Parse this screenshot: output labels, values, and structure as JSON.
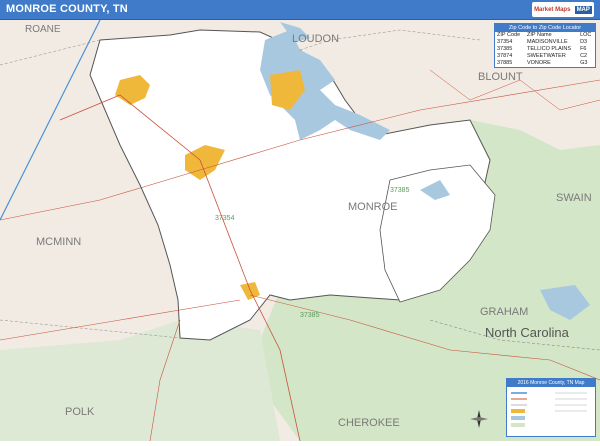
{
  "header": {
    "title": "MONROE COUNTY, TN",
    "logo_text": "Market Maps",
    "logo_badge": "MAP"
  },
  "map": {
    "colors": {
      "county_fill": "#ffffff",
      "surrounding": "#f2ebe4",
      "forest": "#d3e6c8",
      "water": "#a8c8e0",
      "urban": "#f0b83a",
      "road": "#c8523b",
      "border": "#555555",
      "highway": "#4a90d9"
    },
    "region_labels": {
      "roane": "ROANE",
      "loudon": "LOUDON",
      "blount": "BLOUNT",
      "mcminn": "MCMINN",
      "monroe": "MONROE",
      "swain": "SWAIN",
      "graham": "GRAHAM",
      "north_carolina": "North Carolina",
      "polk": "POLK",
      "cherokee": "CHEROKEE"
    },
    "zip_labels": {
      "z37354": "37354",
      "z37385": "37385",
      "z37385b": "37385"
    }
  },
  "zip_locator": {
    "title": "Zip Code to Zip Code Locator",
    "columns": [
      "ZIP Code",
      "ZIP Name",
      "LOC"
    ],
    "rows": [
      [
        "37354",
        "MADISONVILLE",
        "D3"
      ],
      [
        "37385",
        "TELLICO PLAINS",
        "F6"
      ],
      [
        "37874",
        "SWEETWATER",
        "C2"
      ],
      [
        "37885",
        "VONORE",
        "G3"
      ]
    ]
  },
  "legend": {
    "title": "2016 Monroe County, TN Map"
  }
}
